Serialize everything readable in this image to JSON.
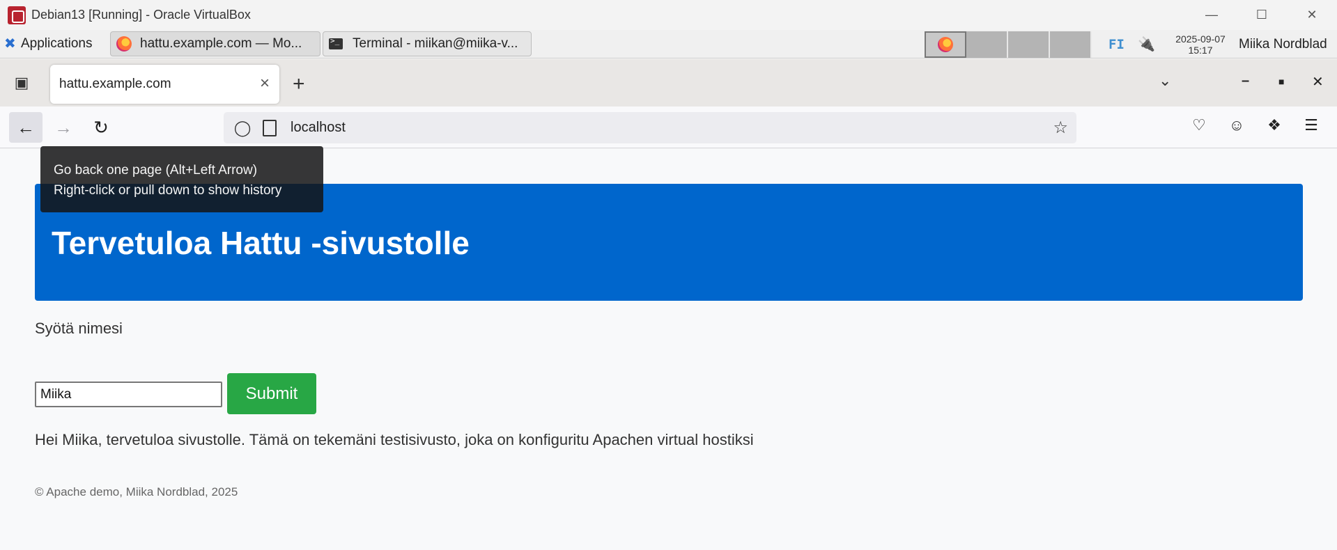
{
  "vbox": {
    "title": "Debian13 [Running] - Oracle VirtualBox",
    "minimize_icon": "minimize-icon",
    "maximize_icon": "maximize-icon",
    "close_icon": "close-icon"
  },
  "panel": {
    "apps_label": "Applications",
    "tasks": [
      {
        "label": "hattu.example.com — Mo...",
        "icon": "firefox-icon"
      },
      {
        "label": "Terminal - miikan@miika-v...",
        "icon": "terminal-icon"
      }
    ],
    "keyboard_layout": "FI",
    "clock_date": "2025-09-07",
    "clock_time": "15:17",
    "user": "Miika Nordblad"
  },
  "browser": {
    "tab_title": "hattu.example.com",
    "tab_close": "×",
    "new_tab": "+",
    "url": "localhost",
    "tooltip_line1": "Go back one page (Alt+Left Arrow)",
    "tooltip_line2": "Right-click or pull down to show history"
  },
  "page": {
    "hero_title": "Tervetuloa Hattu -sivustolle",
    "prompt": "Syötä nimesi",
    "input_value": "Miika",
    "submit_label": "Submit",
    "greeting": "Hei Miika, tervetuloa sivustolle. Tämä on tekemäni testisivusto, joka on konfiguritu Apachen virtual hostiksi",
    "footer": "© Apache demo, Miika Nordblad, 2025"
  },
  "colors": {
    "hero_bg": "#0066cc",
    "submit_bg": "#28a745"
  }
}
